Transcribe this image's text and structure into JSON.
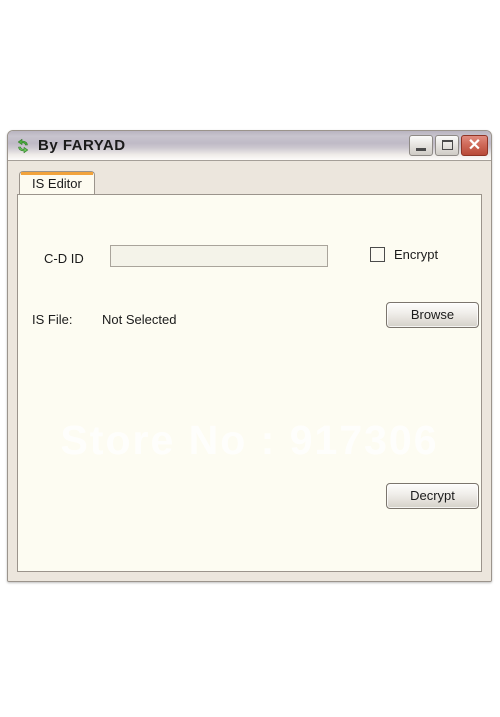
{
  "window": {
    "title": "By FARYAD",
    "icon": "recycle-arrows-icon",
    "controls": {
      "minimize": "Minimize",
      "maximize": "Maximize",
      "close": "✕"
    }
  },
  "tabs": [
    {
      "label": "IS Editor",
      "selected": true
    }
  ],
  "form": {
    "cdid": {
      "label": "C-D ID",
      "value": "",
      "placeholder": ""
    },
    "encrypt": {
      "label": "Encrypt",
      "checked": false
    },
    "isfile": {
      "label": "IS File:",
      "value": "Not Selected"
    },
    "browse_button": "Browse",
    "decrypt_button": "Decrypt"
  },
  "watermark": {
    "text": "Store No : 917306"
  },
  "colors": {
    "tab_accent": "#f2a33c",
    "close_button": "#b84a38",
    "client_background": "#fdfcf2",
    "window_background": "#ece6dd"
  }
}
